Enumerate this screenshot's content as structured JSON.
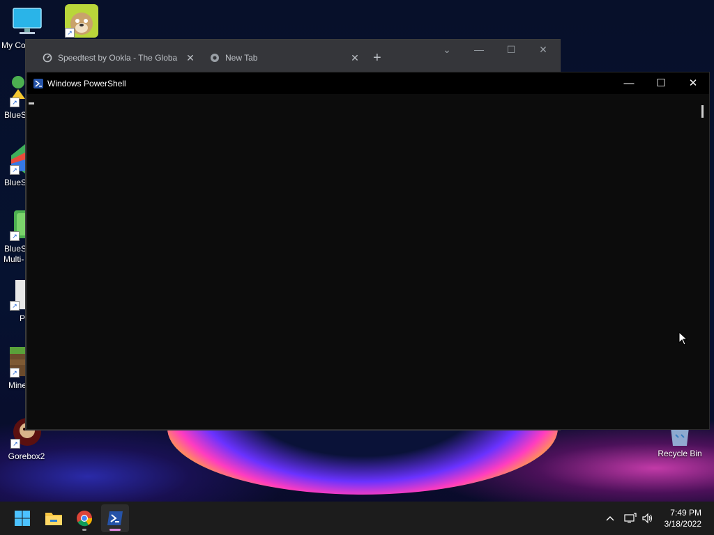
{
  "desktop": {
    "icons": [
      {
        "label": "My Co",
        "icon": "monitor-icon"
      },
      {
        "label": "",
        "icon": "talking-ben-icon"
      },
      {
        "label": "BlueSt",
        "icon": "bluestacks-icon"
      },
      {
        "label": "BlueSt",
        "icon": "bluestacks-x-icon"
      },
      {
        "label": "BlueSt",
        "label2": "Multi-",
        "icon": "bluestacks-multi-icon"
      },
      {
        "label": "P",
        "icon": "file-icon"
      },
      {
        "label": "Mine",
        "icon": "minecraft-icon"
      },
      {
        "label": "Gorebox2",
        "icon": "gorebox-icon"
      },
      {
        "label": "Recycle Bin",
        "icon": "recycle-bin-icon"
      }
    ]
  },
  "chrome": {
    "tabs": [
      {
        "title": "Speedtest by Ookla - The Global",
        "icon": "speedtest-icon"
      },
      {
        "title": "New Tab",
        "icon": "chrome-icon"
      }
    ],
    "new_tab_symbol": "+",
    "close_symbol": "✕"
  },
  "powershell": {
    "title": "Windows PowerShell",
    "minimize": "—",
    "maximize": "☐",
    "close": "✕"
  },
  "taskbar": {
    "pinned": [
      {
        "name": "start-button",
        "icon": "windows-icon"
      },
      {
        "name": "file-explorer",
        "icon": "folder-icon"
      },
      {
        "name": "chrome",
        "icon": "chrome-icon"
      },
      {
        "name": "powershell",
        "icon": "powershell-icon"
      }
    ],
    "tray": {
      "chevron": "^",
      "time": "7:49 PM",
      "date": "3/18/2022"
    }
  },
  "colors": {
    "accent": "#e089e0",
    "terminal_bg": "#0c0c0c",
    "chrome_tabbar": "#35363a"
  }
}
